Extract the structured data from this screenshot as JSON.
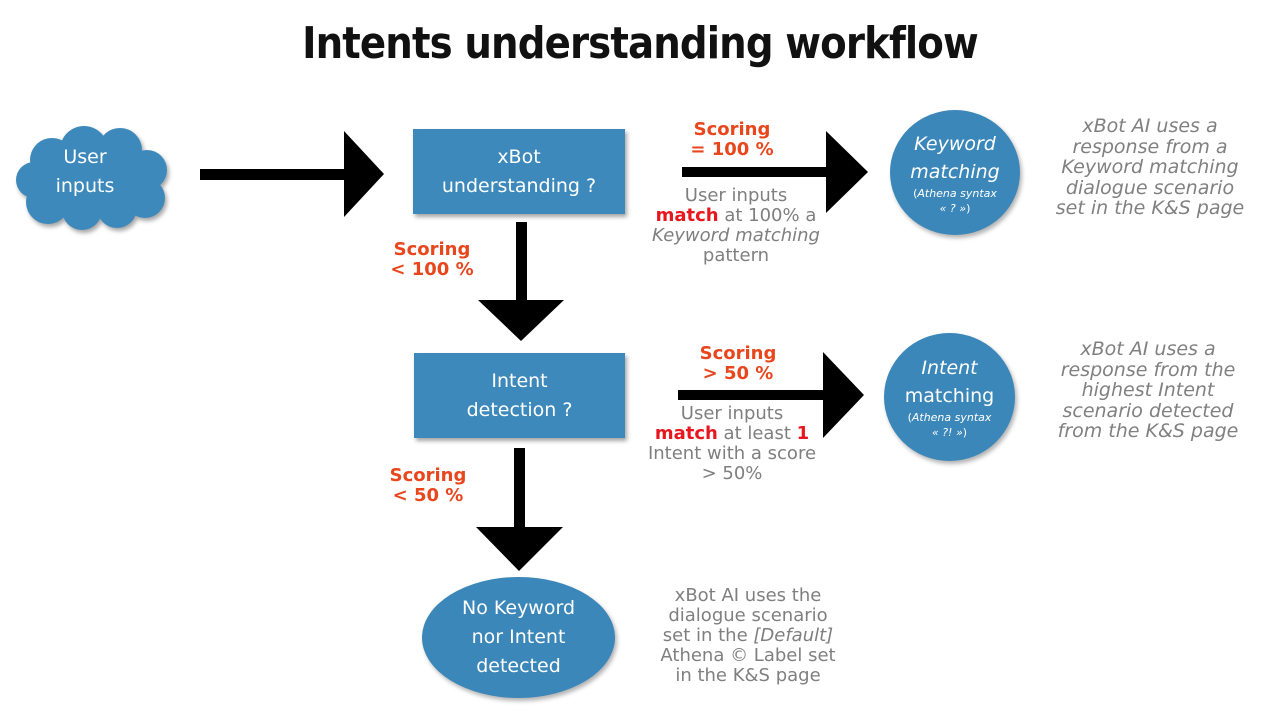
{
  "title": "Intents understanding workflow",
  "colors": {
    "node": "#3d89bb",
    "scoring": "#e8461d",
    "highlight": "#e8161d",
    "description": "#7f7f7f",
    "arrow": "#000000"
  },
  "nodes": {
    "user_inputs": {
      "shape": "cloud",
      "lines": [
        "User",
        "inputs"
      ]
    },
    "xbot_understanding": {
      "shape": "rectangle",
      "lines": [
        "xBot",
        "understanding ?"
      ]
    },
    "intent_detection": {
      "shape": "rectangle",
      "lines": [
        "Intent",
        "detection ?"
      ]
    },
    "keyword_matching": {
      "shape": "ellipse",
      "title": [
        "Keyword",
        "matching"
      ],
      "note_prefix": "(",
      "note_syntax": "Athena syntax",
      "note_symbol": "« ? »",
      "note_suffix": ")"
    },
    "intent_matching": {
      "shape": "ellipse",
      "title_italic": "Intent",
      "title": "matching",
      "note_prefix": "(",
      "note_syntax": "Athena syntax",
      "note_symbol": "« ?! »",
      "note_suffix": ")"
    },
    "no_match": {
      "shape": "ellipse",
      "lines": [
        "No Keyword",
        "nor Intent",
        "detected"
      ]
    }
  },
  "edges": {
    "to_keyword": {
      "scoring": [
        "Scoring",
        "= 100 %"
      ],
      "desc_line1": "User inputs",
      "desc_match": "match",
      "desc_line2_rest": " at 100% a",
      "desc_line3_italic": "Keyword matching",
      "desc_line4": "pattern"
    },
    "to_intent_detection": {
      "scoring": [
        "Scoring",
        "< 100 %"
      ]
    },
    "to_intent": {
      "scoring": [
        "Scoring",
        "> 50 %"
      ],
      "desc_line1": "User inputs",
      "desc_match": "match",
      "desc_line2_mid": " at least ",
      "desc_line2_num": "1",
      "desc_line3": "Intent with a score",
      "desc_line4": "> 50%"
    },
    "to_no_match": {
      "scoring": [
        "Scoring",
        "< 50 %"
      ]
    }
  },
  "results": {
    "keyword": [
      "xBot AI uses a",
      "response from a",
      "Keyword matching",
      "dialogue scenario",
      "set in the K&S page"
    ],
    "intent": [
      "xBot AI uses a",
      "response from the",
      "highest Intent",
      "scenario detected",
      "from the K&S page"
    ],
    "default": {
      "line1": "xBot AI uses the",
      "line2": "dialogue scenario",
      "line3_prefix": "set in the ",
      "line3_italic": "[Default]",
      "line4": "Athena © Label set",
      "line5": "in the K&S page"
    }
  }
}
